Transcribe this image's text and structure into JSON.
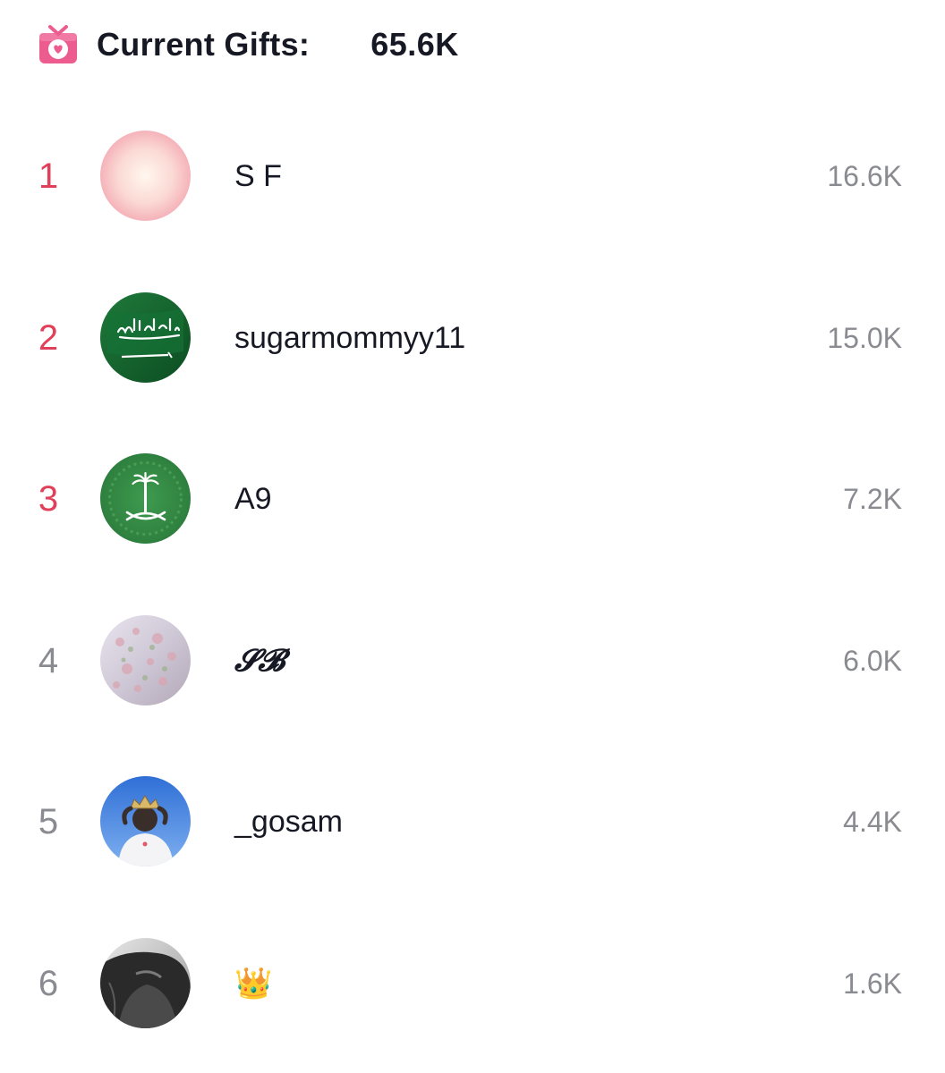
{
  "header": {
    "icon": "gift-icon",
    "label": "Current Gifts:",
    "value": "65.6K",
    "icon_color": "#ec5c8f"
  },
  "colors": {
    "top_rank": "#e2405a",
    "rank": "#8a8b91",
    "amount": "#8a8b91",
    "text": "#161823"
  },
  "leaderboard": {
    "items": [
      {
        "rank": "1",
        "username": "S F",
        "amount": "16.6K",
        "avatar": "pink-gradient-avatar"
      },
      {
        "rank": "2",
        "username": "sugarmommyy11",
        "amount": "15.0K",
        "avatar": "saudi-flag-avatar"
      },
      {
        "rank": "3",
        "username": "A9",
        "amount": "7.2K",
        "avatar": "palm-swords-emblem-avatar"
      },
      {
        "rank": "4",
        "username": "𝓢𝓑",
        "amount": "6.0K",
        "avatar": "floral-pattern-avatar"
      },
      {
        "rank": "5",
        "username": "_gosam",
        "amount": "4.4K",
        "avatar": "crowned-figure-avatar"
      },
      {
        "rank": "6",
        "username": "👑",
        "amount": "1.6K",
        "avatar": "grayscale-portrait-avatar"
      }
    ]
  }
}
